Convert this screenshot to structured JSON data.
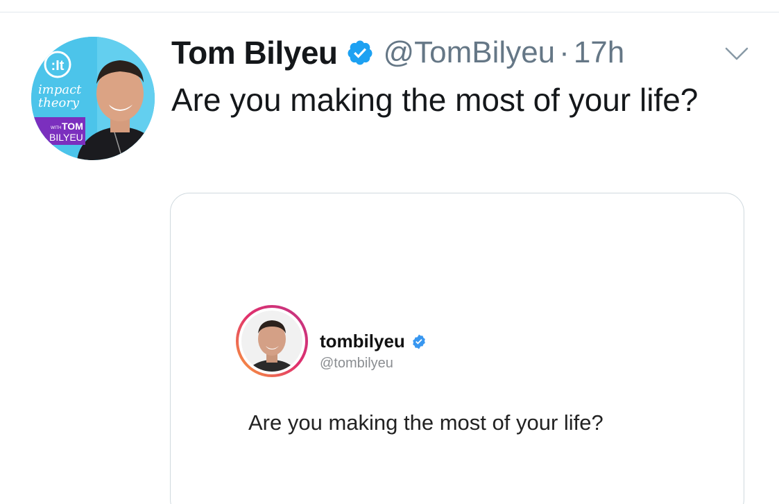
{
  "tweet": {
    "author_name": "Tom Bilyeu",
    "author_handle": "@TomBilyeu",
    "separator": "·",
    "time": "17h",
    "text": "Are you making the most of your life?",
    "avatar_logo_text": ":It",
    "avatar_brand_line1": "impact",
    "avatar_brand_line2": "theory",
    "avatar_with": "WITH",
    "avatar_tom": "TOM",
    "avatar_bilyeu": "BILYEU",
    "icons": {
      "verified": "verified-badge-icon",
      "menu": "chevron-down-icon"
    }
  },
  "embed": {
    "username": "tombilyeu",
    "handle": "@tombilyeu",
    "text": "Are you making the most of your life?"
  },
  "colors": {
    "verified_blue": "#1da1f2",
    "secondary_text": "#657786",
    "avatar_bg": "#4cc4ea",
    "avatar_banner": "#7b2fbe"
  }
}
